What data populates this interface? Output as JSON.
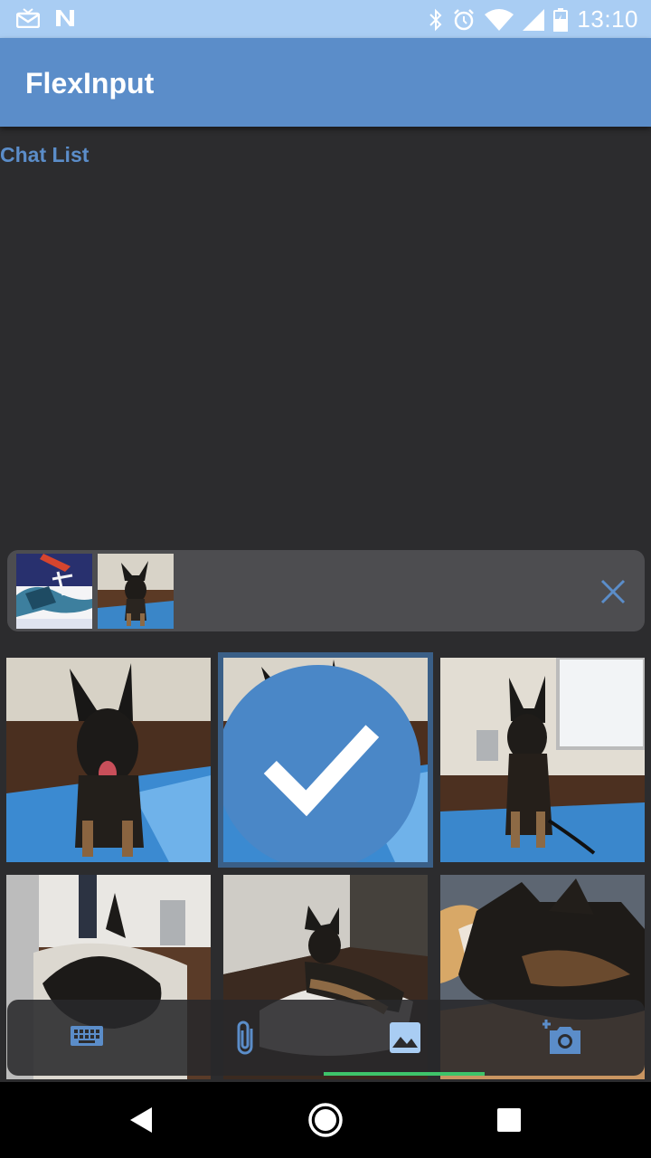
{
  "status_bar": {
    "time": "13:10",
    "left_icons": [
      "mail-notification-icon",
      "n-notification-icon"
    ],
    "right_icons": [
      "bluetooth-icon",
      "alarm-icon",
      "wifi-icon",
      "signal-icon",
      "battery-icon"
    ]
  },
  "app_bar": {
    "title": "FlexInput"
  },
  "chat": {
    "label": "Chat List"
  },
  "attachments": {
    "items": [
      {
        "name": "comic-thumbnail"
      },
      {
        "name": "dog-thumbnail"
      }
    ],
    "clear_icon": "close-icon"
  },
  "gallery": {
    "photos": [
      {
        "name": "dog-photo-1",
        "selected": false
      },
      {
        "name": "dog-photo-2",
        "selected": true
      },
      {
        "name": "dog-photo-3",
        "selected": false
      },
      {
        "name": "dog-photo-4",
        "selected": false
      },
      {
        "name": "dog-photo-5",
        "selected": false
      },
      {
        "name": "dog-photo-6",
        "selected": false
      }
    ]
  },
  "toolbar": {
    "tools": [
      "keyboard-icon",
      "attachment-icon",
      "image-icon",
      "add-photo-icon"
    ],
    "active_tool": "image-icon"
  },
  "nav_bar": {
    "buttons": [
      "back-button",
      "home-button",
      "recents-button"
    ]
  },
  "colors": {
    "status_bar": "#a9cdf3",
    "app_bar": "#5b8dc9",
    "background": "#2c2c2e",
    "accent": "#5b8dc9",
    "indicator": "#3ec46a"
  }
}
